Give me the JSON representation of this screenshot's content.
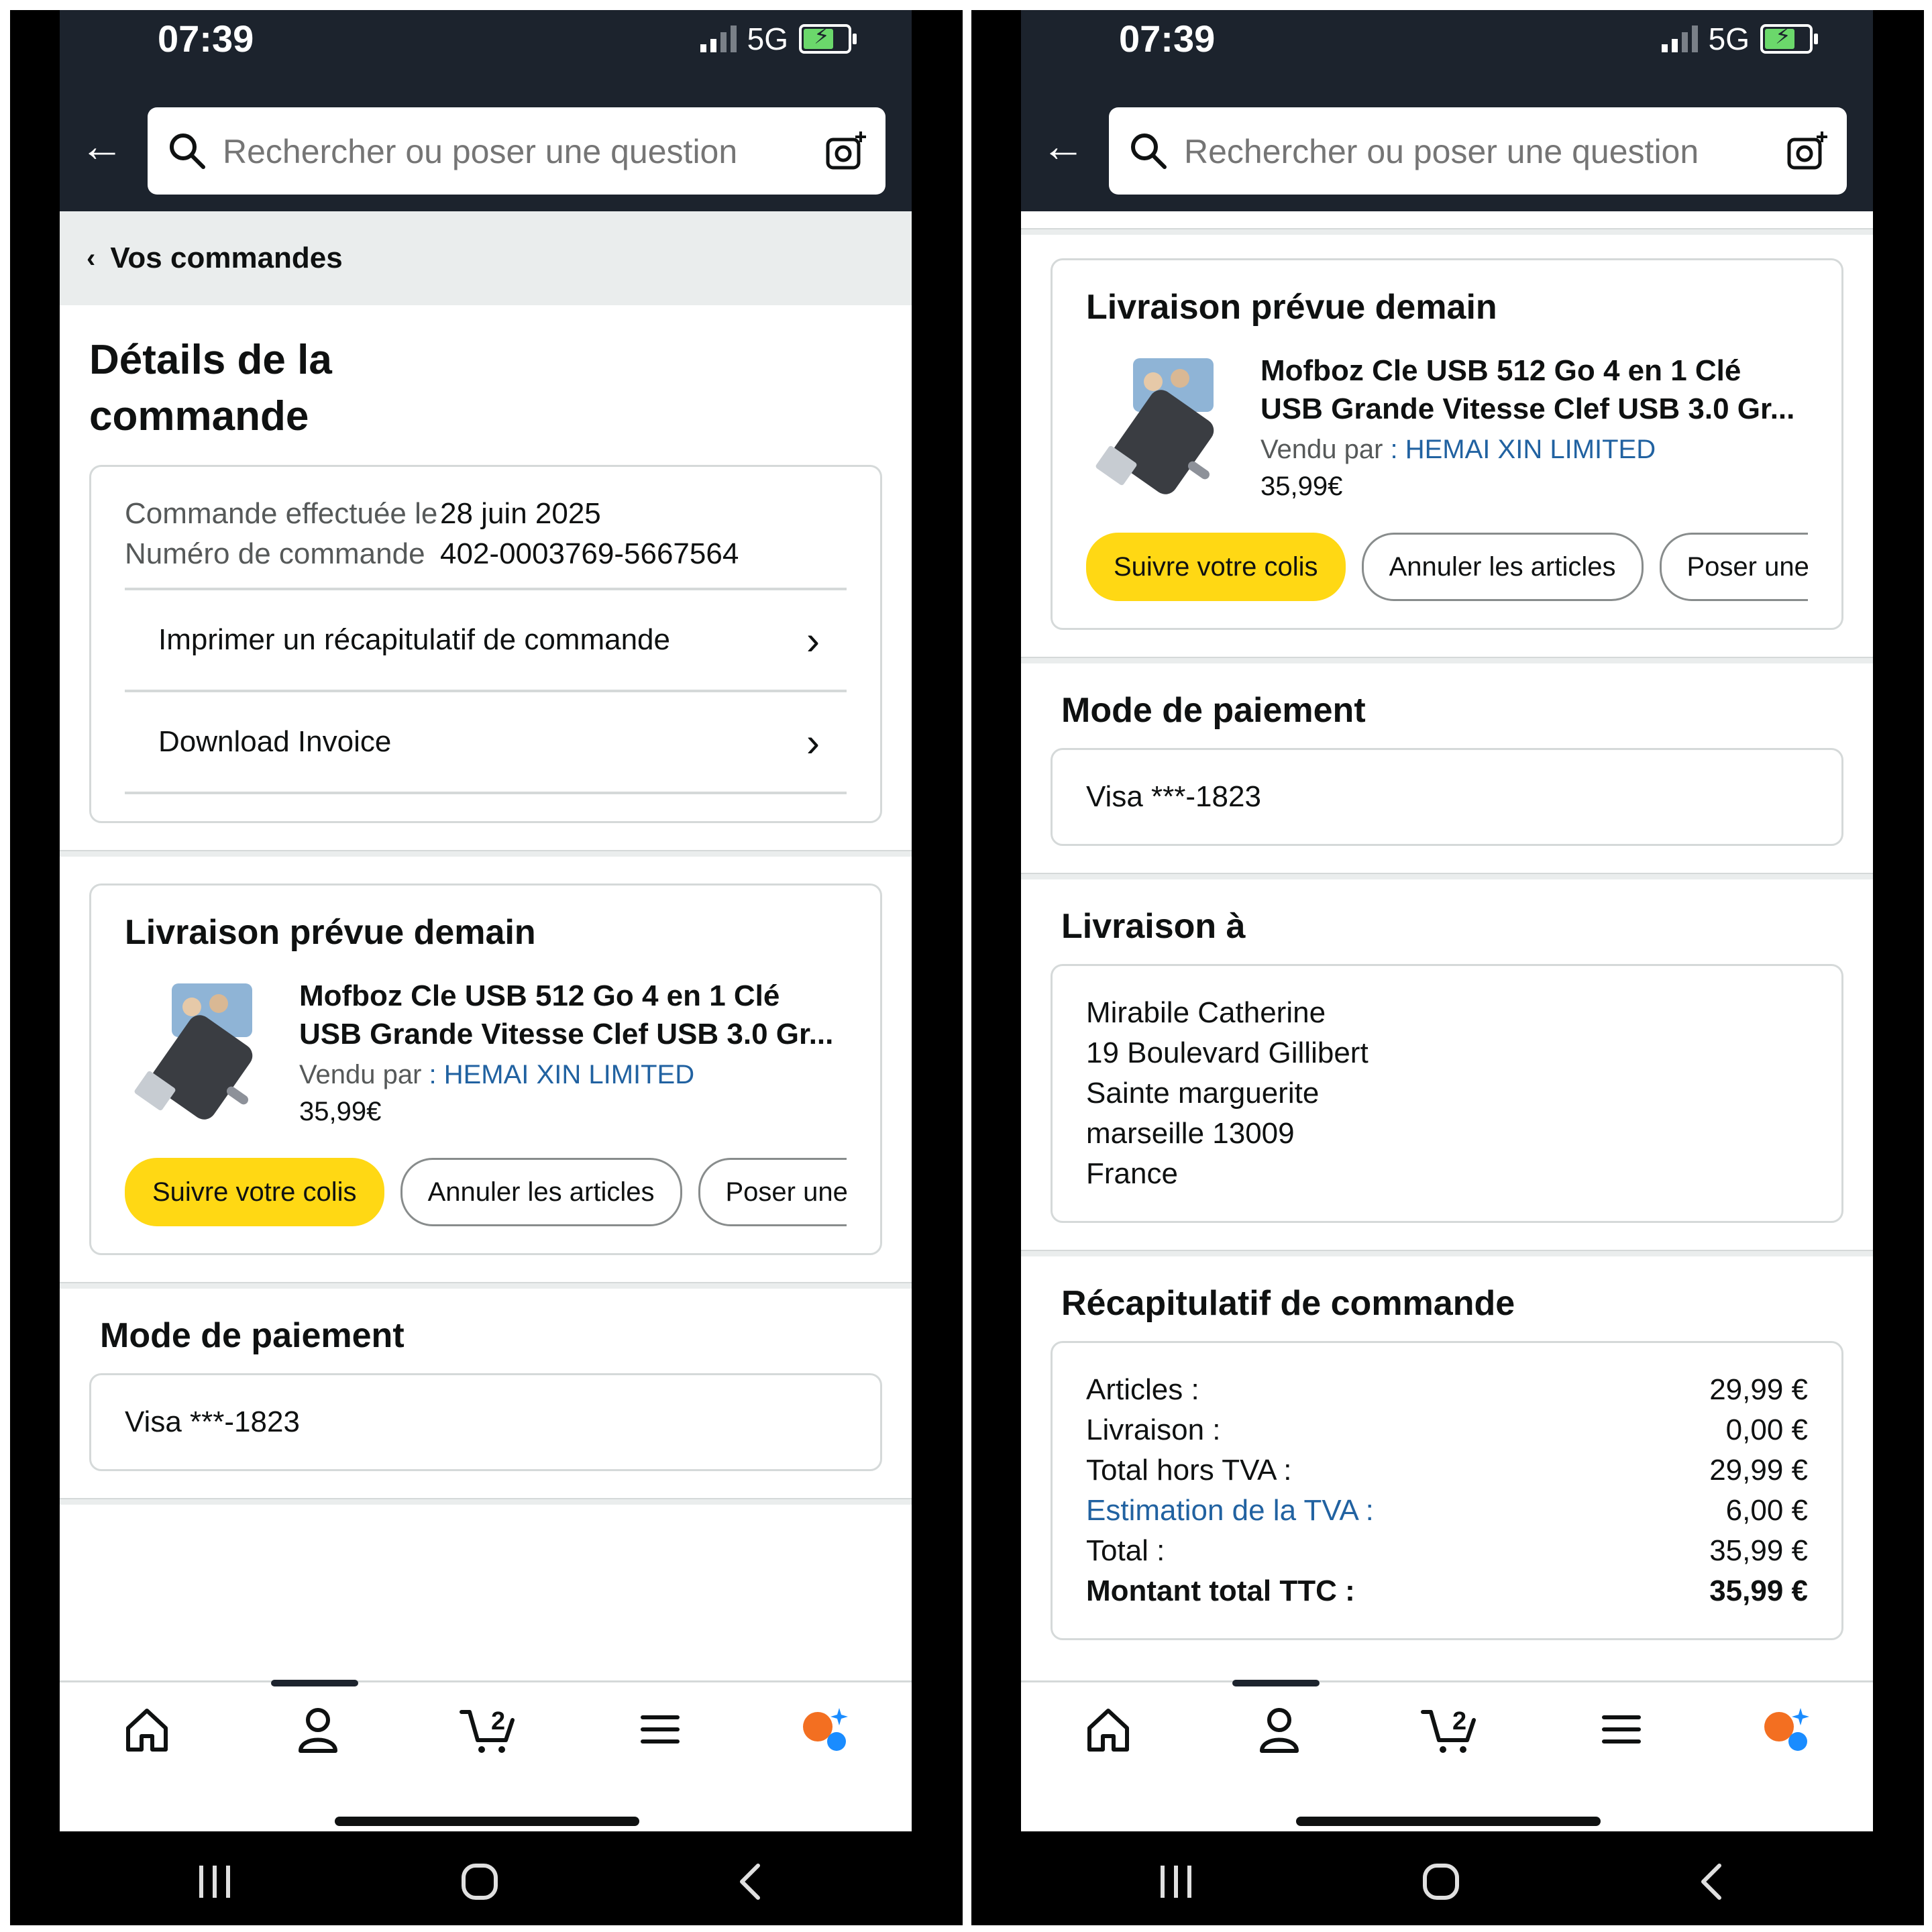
{
  "status": {
    "time": "07:39",
    "network": "5G"
  },
  "search": {
    "placeholder": "Rechercher ou poser une question"
  },
  "breadcrumb": {
    "label": "Vos commandes"
  },
  "page": {
    "title": "Détails de la commande"
  },
  "order_info": {
    "date_label": "Commande effectuée le",
    "number_label": "Numéro de commande",
    "date_value": "28 juin 2025",
    "number_value": "402-0003769-5667564",
    "print_summary_label": "Imprimer un récapitulatif de commande",
    "download_invoice_label": "Download Invoice"
  },
  "delivery": {
    "heading": "Livraison prévue demain",
    "item_title": "Mofboz Cle USB 512 Go 4 en 1 Clé USB Grande Vitesse Clef USB 3.0 Gr...",
    "sold_by_label": "Vendu par",
    "seller": ": HEMAI XIN LIMITED",
    "price": "35,99€",
    "buttons": {
      "track": "Suivre votre colis",
      "cancel": "Annuler les articles",
      "ask": "Poser une qu"
    }
  },
  "payment": {
    "heading": "Mode de paiement",
    "method": "Visa ***-1823"
  },
  "shipping": {
    "heading": "Livraison à",
    "lines": [
      "Mirabile Catherine",
      "19 Boulevard Gillibert",
      "Sainte marguerite",
      "marseille 13009",
      "France"
    ]
  },
  "summary": {
    "heading": "Récapitulatif de commande",
    "rows": [
      {
        "label": "Articles :",
        "value": "29,99 €"
      },
      {
        "label": "Livraison :",
        "value": "0,00 €"
      },
      {
        "label": "Total hors TVA :",
        "value": "29,99 €"
      },
      {
        "label": "Estimation de la TVA :",
        "value": "6,00 €"
      },
      {
        "label": "Total :",
        "value": "35,99 €"
      },
      {
        "label": "Montant total TTC :",
        "value": "35,99 €"
      }
    ]
  },
  "tabbar": {
    "cart_count": "2",
    "icons": [
      "home-icon",
      "account-icon",
      "cart-icon",
      "menu-icon",
      "assistant-icon"
    ]
  },
  "colors": {
    "header": "#1c232d",
    "primary_button": "#ffd814",
    "link": "#2162a1"
  }
}
